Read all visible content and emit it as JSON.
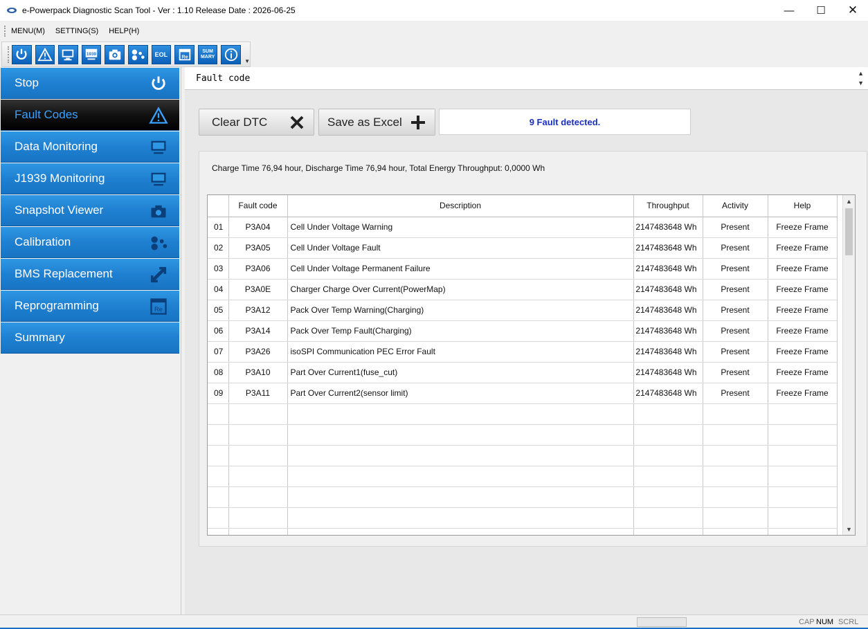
{
  "window": {
    "title": "e-Powerpack Diagnostic Scan Tool - Ver : 1.10 Release Date : 2026-06-25"
  },
  "menu": [
    {
      "label": "MENU(M)"
    },
    {
      "label": "SETTING(S)"
    },
    {
      "label": "HELP(H)"
    }
  ],
  "toolbar": {
    "buttons": [
      {
        "icon": "power-icon"
      },
      {
        "icon": "warning-icon"
      },
      {
        "icon": "monitor-icon"
      },
      {
        "icon": "j1939-monitor-icon",
        "text": "1939"
      },
      {
        "icon": "camera-icon"
      },
      {
        "icon": "calibration-icon"
      },
      {
        "icon": "eol-icon",
        "text": "EOL"
      },
      {
        "icon": "reprogram-icon",
        "text": "Re"
      },
      {
        "icon": "summary-icon",
        "text": "SUM MARY"
      },
      {
        "icon": "info-icon"
      }
    ]
  },
  "sidebar": {
    "items": [
      {
        "label": "Stop",
        "icon": "power-icon"
      },
      {
        "label": "Fault Codes",
        "icon": "warning-icon",
        "active": true
      },
      {
        "label": "Data Monitoring",
        "icon": "monitor-icon"
      },
      {
        "label": "J1939 Monitoring",
        "icon": "monitor-icon"
      },
      {
        "label": "Snapshot Viewer",
        "icon": "camera-icon"
      },
      {
        "label": "Calibration",
        "icon": "calibration-icon"
      },
      {
        "label": "BMS Replacement",
        "icon": "replace-arrows-icon"
      },
      {
        "label": "Reprogramming",
        "icon": "reprogram-icon"
      },
      {
        "label": "Summary",
        "icon": ""
      }
    ]
  },
  "main": {
    "section_title": "Fault code",
    "clear_label": "Clear DTC",
    "save_label": "Save as Excel",
    "status": "9 Fault detected.",
    "info": "Charge Time 76,94 hour, Discharge Time 76,94 hour, Total Energy Throughput: 0,0000 Wh",
    "columns": [
      "",
      "Fault code",
      "Description",
      "Throughput",
      "Activity",
      "Help"
    ],
    "rows": [
      [
        "01",
        "P3A04",
        "Cell Under Voltage Warning",
        "2147483648 Wh",
        "Present",
        "Freeze Frame"
      ],
      [
        "02",
        "P3A05",
        "Cell Under Voltage Fault",
        "2147483648 Wh",
        "Present",
        "Freeze Frame"
      ],
      [
        "03",
        "P3A06",
        "Cell Under Voltage Permanent Failure",
        "2147483648 Wh",
        "Present",
        "Freeze Frame"
      ],
      [
        "04",
        "P3A0E",
        "Charger Charge Over Current(PowerMap)",
        "2147483648 Wh",
        "Present",
        "Freeze Frame"
      ],
      [
        "05",
        "P3A12",
        "Pack Over Temp Warning(Charging)",
        "2147483648 Wh",
        "Present",
        "Freeze Frame"
      ],
      [
        "06",
        "P3A14",
        "Pack Over Temp Fault(Charging)",
        "2147483648 Wh",
        "Present",
        "Freeze Frame"
      ],
      [
        "07",
        "P3A26",
        "isoSPI Communication PEC Error Fault",
        "2147483648 Wh",
        "Present",
        "Freeze Frame"
      ],
      [
        "08",
        "P3A10",
        "Part Over Current1(fuse_cut)",
        "2147483648 Wh",
        "Present",
        "Freeze Frame"
      ],
      [
        "09",
        "P3A11",
        "Part Over Current2(sensor limit)",
        "2147483648 Wh",
        "Present",
        "Freeze Frame"
      ]
    ],
    "empty_rows": 7
  },
  "statusbar": {
    "cap": "CAP",
    "num": "NUM",
    "scrl": "SCRL"
  },
  "colors": {
    "nav_blue": "#1f80d1",
    "nav_active": "#111111",
    "active_text": "#3aa0ff",
    "status_text": "#1a2fbf"
  }
}
